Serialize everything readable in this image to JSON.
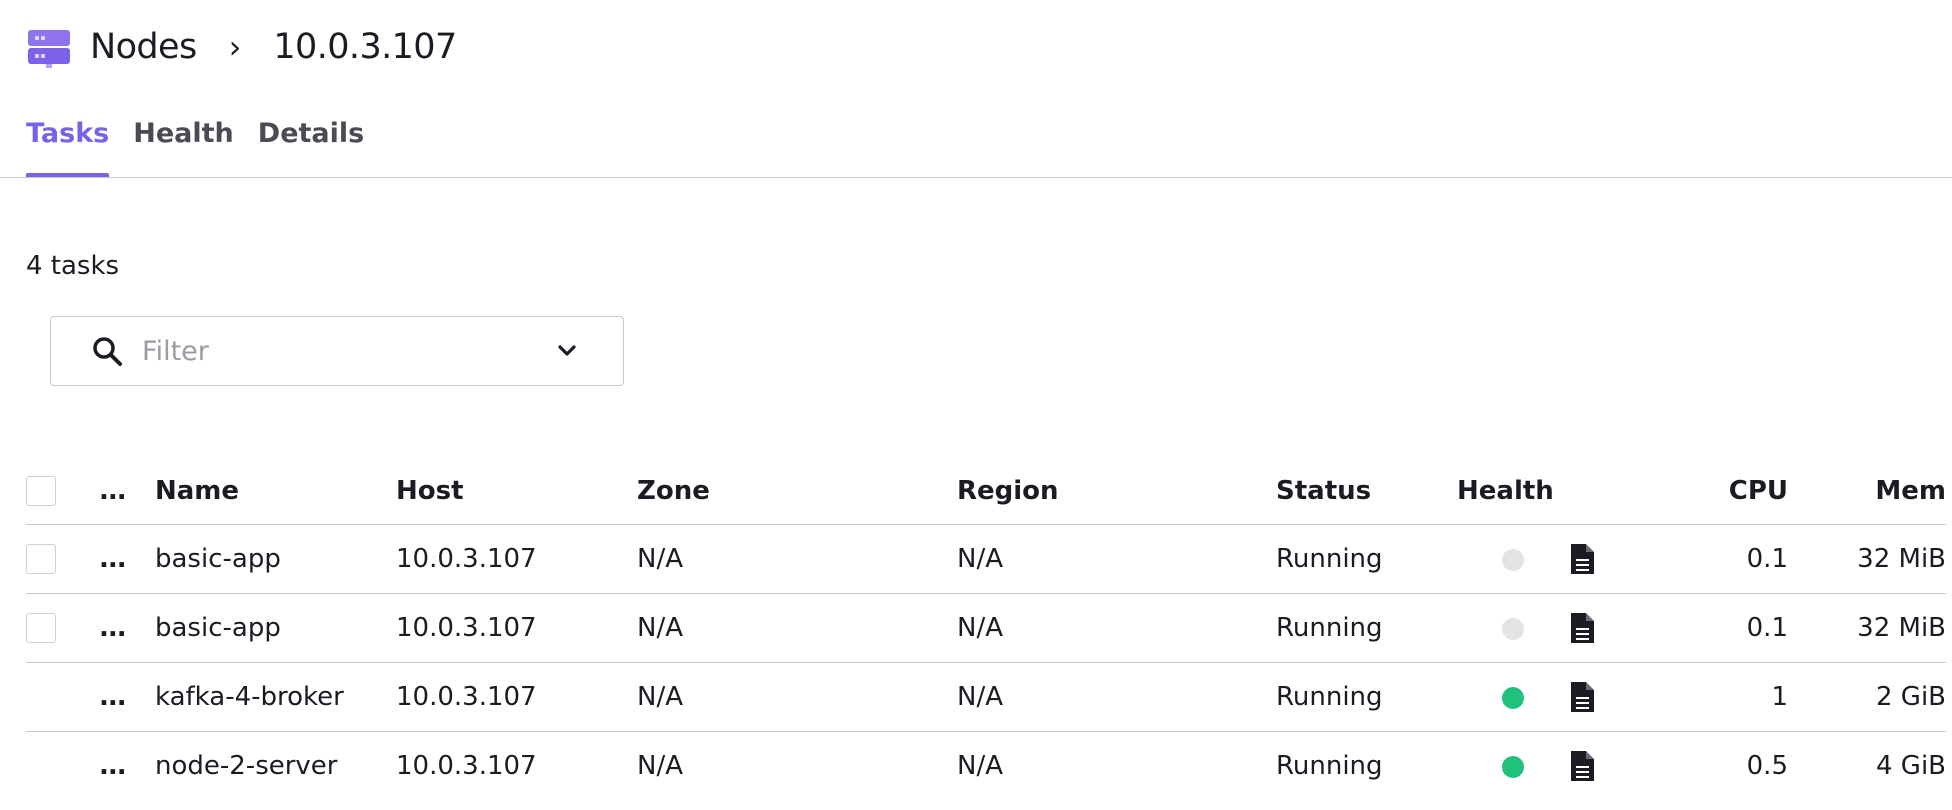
{
  "breadcrumb": {
    "icon": "server-icon",
    "parent": "Nodes",
    "separator": "›",
    "current": "10.0.3.107"
  },
  "tabs": [
    {
      "label": "Tasks",
      "active": true
    },
    {
      "label": "Health",
      "active": false
    },
    {
      "label": "Details",
      "active": false
    }
  ],
  "summary": {
    "task_count": "4 tasks"
  },
  "filter": {
    "placeholder": "Filter",
    "value": "",
    "search_icon": "search-icon",
    "dropdown_icon": "chevron-down-icon"
  },
  "table": {
    "columns": {
      "select": "",
      "more": "...",
      "name": "Name",
      "host": "Host",
      "zone": "Zone",
      "region": "Region",
      "status": "Status",
      "health": "Health",
      "logs": "",
      "cpu": "CPU",
      "mem": "Mem"
    },
    "rows": [
      {
        "selectable": true,
        "more": "...",
        "name": "basic-app",
        "host": "10.0.3.107",
        "zone": "N/A",
        "region": "N/A",
        "status": "Running",
        "health": "unknown",
        "log_icon": "file-text-icon",
        "cpu": "0.1",
        "mem": "32 MiB"
      },
      {
        "selectable": true,
        "more": "...",
        "name": "basic-app",
        "host": "10.0.3.107",
        "zone": "N/A",
        "region": "N/A",
        "status": "Running",
        "health": "unknown",
        "log_icon": "file-text-icon",
        "cpu": "0.1",
        "mem": "32 MiB"
      },
      {
        "selectable": false,
        "more": "...",
        "name": "kafka-4-broker",
        "host": "10.0.3.107",
        "zone": "N/A",
        "region": "N/A",
        "status": "Running",
        "health": "healthy",
        "log_icon": "file-text-icon",
        "cpu": "1",
        "mem": "2 GiB"
      },
      {
        "selectable": false,
        "more": "...",
        "name": "node-2-server",
        "host": "10.0.3.107",
        "zone": "N/A",
        "region": "N/A",
        "status": "Running",
        "health": "healthy",
        "log_icon": "file-text-icon",
        "cpu": "0.5",
        "mem": "4 GiB"
      }
    ]
  },
  "colors": {
    "accent": "#7b61e8",
    "healthy": "#20c07d",
    "unknown": "#e4e4e7",
    "text": "#1b1b24"
  }
}
